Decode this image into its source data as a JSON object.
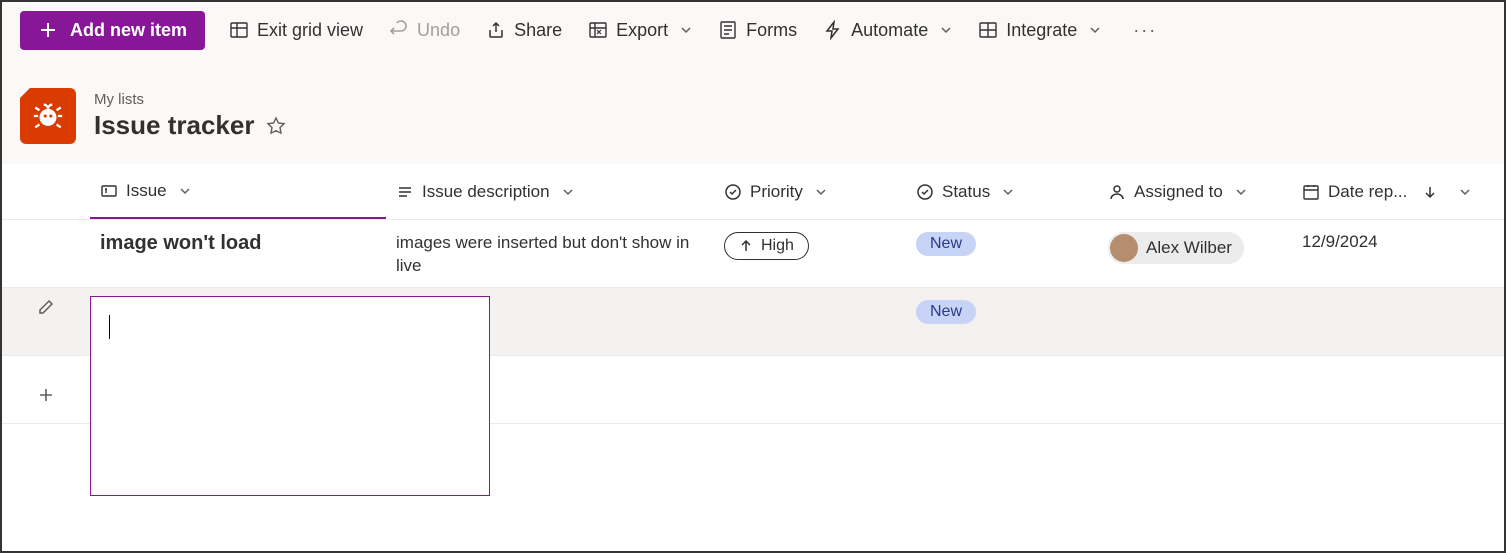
{
  "toolbar": {
    "add_label": "Add new item",
    "exit_grid": "Exit grid view",
    "undo": "Undo",
    "share": "Share",
    "export": "Export",
    "forms": "Forms",
    "automate": "Automate",
    "integrate": "Integrate"
  },
  "header": {
    "breadcrumb": "My lists",
    "title": "Issue tracker"
  },
  "columns": {
    "issue": "Issue",
    "description": "Issue description",
    "priority": "Priority",
    "status": "Status",
    "assigned": "Assigned to",
    "date": "Date rep..."
  },
  "rows": [
    {
      "issue": "image won't load",
      "description": "images were inserted but don't show in live",
      "priority": "High",
      "status": "New",
      "assigned": "Alex Wilber",
      "date": "12/9/2024"
    },
    {
      "issue": "",
      "description": "",
      "priority": "",
      "status": "New",
      "assigned": "",
      "date": ""
    }
  ]
}
